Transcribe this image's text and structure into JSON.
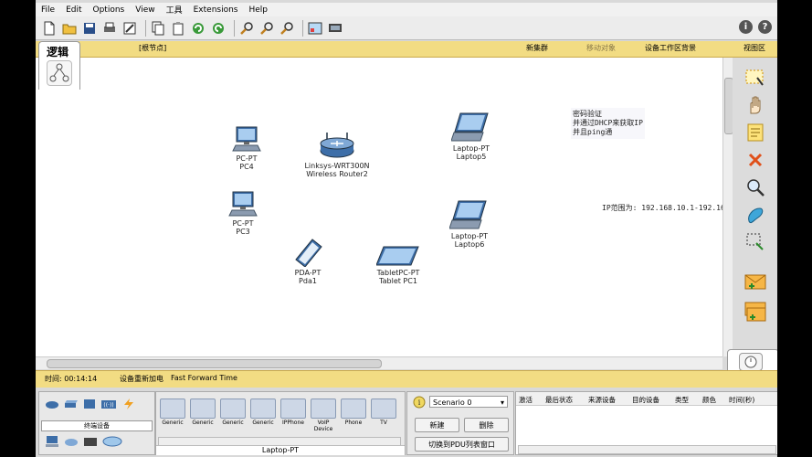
{
  "menu": [
    "File",
    "Edit",
    "Options",
    "View",
    "工具",
    "Extensions",
    "Help"
  ],
  "logical_bar": {
    "tab_label": "逻辑",
    "root_label": "[根节点]",
    "new_cluster": "新集群",
    "move_object": "移动对象",
    "set_background": "设备工作区背景",
    "viewport": "视图区"
  },
  "devices": [
    {
      "type": "PC-PT",
      "name": "PC4",
      "kind": "pc"
    },
    {
      "type": "Linksys-WRT300N",
      "name": "Wireless Router2",
      "kind": "router"
    },
    {
      "type": "Laptop-PT",
      "name": "Laptop5",
      "kind": "laptop"
    },
    {
      "type": "PC-PT",
      "name": "PC3",
      "kind": "pc"
    },
    {
      "type": "Laptop-PT",
      "name": "Laptop6",
      "kind": "laptop"
    },
    {
      "type": "PDA-PT",
      "name": "Pda1",
      "kind": "pda"
    },
    {
      "type": "TabletPC-PT",
      "name": "Tablet PC1",
      "kind": "tablet"
    }
  ],
  "notes": {
    "note1": [
      "密码验证",
      "并通过DHCP来获取IP",
      "并且ping通"
    ],
    "note2": "IP范围为: 192.168.10.1-192.16"
  },
  "status": {
    "time_label": "时间: 00:14:14",
    "power_cycle": "设备重新加电",
    "fast_forward": "Fast Forward Time",
    "realtime": "实时"
  },
  "device_palette": {
    "category_label": "终端设备",
    "items": [
      "Generic",
      "Generic",
      "Generic",
      "Generic",
      "IPPhone",
      "VoIP Device",
      "Phone",
      "TV"
    ],
    "selected": "Laptop-PT"
  },
  "scenario": {
    "selected": "Scenario 0",
    "new_label": "新建",
    "delete_label": "删除",
    "toggle_label": "切换到PDU列表窗口"
  },
  "pdu_columns": [
    "激活",
    "最后状态",
    "来源设备",
    "目的设备",
    "类型",
    "颜色",
    "时间(秒)"
  ],
  "colors": {
    "accent_yellow": "#f2dc83",
    "canvas": "#ffffff",
    "frame": "#d9d9d9"
  }
}
